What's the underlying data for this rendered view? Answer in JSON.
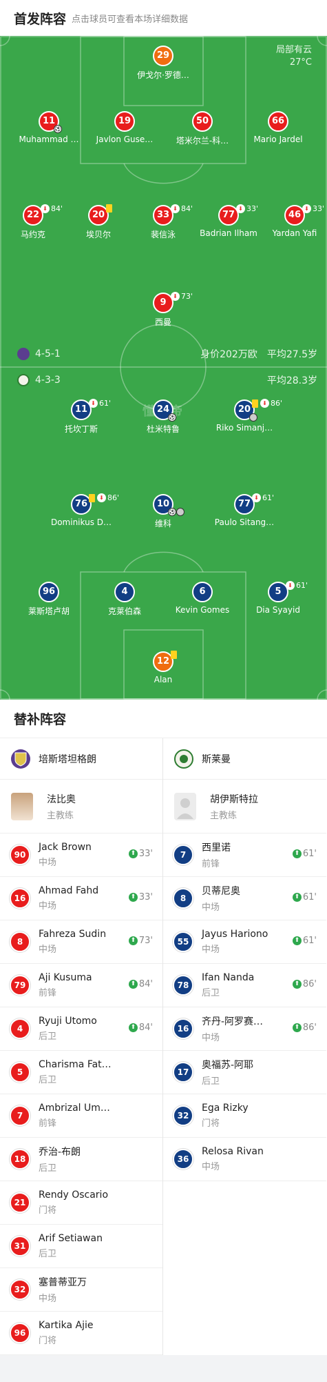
{
  "header": {
    "title": "首发阵容",
    "subtitle": "点击球员可查看本场详细数据"
  },
  "weather": {
    "condition": "局部有云",
    "temp": "27°C"
  },
  "watermark": "懂球帝",
  "home_bar": {
    "formation": "4-5-1",
    "value": "身价202万欧",
    "age": "平均27.5岁"
  },
  "away_bar": {
    "formation": "4-3-3",
    "age": "平均28.3岁"
  },
  "home_lineup": [
    {
      "num": "29",
      "name": "伊戈尔·罗德…",
      "color": "orange"
    },
    {
      "num": "11",
      "name": "Muhammad …",
      "color": "red",
      "goal": true
    },
    {
      "num": "19",
      "name": "Javlon Guse…",
      "color": "red"
    },
    {
      "num": "50",
      "name": "塔米尔兰-科…",
      "color": "red"
    },
    {
      "num": "66",
      "name": "Mario Jardel",
      "color": "red"
    },
    {
      "num": "22",
      "name": "马约克",
      "color": "red",
      "sub": "84'"
    },
    {
      "num": "20",
      "name": "埃贝尔",
      "color": "red",
      "yellow": true
    },
    {
      "num": "33",
      "name": "裴信泳",
      "color": "red",
      "sub": "84'"
    },
    {
      "num": "77",
      "name": "Badrian Ilham",
      "color": "red",
      "sub": "33'"
    },
    {
      "num": "46",
      "name": "Yardan Yafi",
      "color": "red",
      "sub": "33'"
    },
    {
      "num": "9",
      "name": "西曼",
      "color": "red",
      "sub": "73'"
    }
  ],
  "away_lineup": [
    {
      "num": "11",
      "name": "托坎丁斯",
      "color": "blue",
      "sub": "61'"
    },
    {
      "num": "24",
      "name": "杜米特鲁",
      "color": "blue",
      "goal": true
    },
    {
      "num": "20",
      "name": "Riko Simanj…",
      "color": "blue",
      "yellow": true,
      "sub": "86'",
      "owngoal": true
    },
    {
      "num": "76",
      "name": "Dominikus D…",
      "color": "blue",
      "yellow": true,
      "sub": "86'"
    },
    {
      "num": "10",
      "name": "维科",
      "color": "blue",
      "goal": true,
      "owngoal": true
    },
    {
      "num": "77",
      "name": "Paulo Sitang…",
      "color": "blue",
      "sub": "61'"
    },
    {
      "num": "96",
      "name": "莱斯塔卢胡",
      "color": "blue"
    },
    {
      "num": "4",
      "name": "克莱伯森",
      "color": "blue"
    },
    {
      "num": "6",
      "name": "Kevin Gomes",
      "color": "blue"
    },
    {
      "num": "5",
      "name": "Dia Syayid",
      "color": "blue",
      "sub": "61'"
    },
    {
      "num": "12",
      "name": "Alan",
      "color": "orange",
      "yellow": true
    }
  ],
  "bench": {
    "title": "替补阵容",
    "home": {
      "team": "培斯塔坦格朗",
      "coach": {
        "name": "法比奥",
        "role": "主教练"
      },
      "players": [
        {
          "num": "90",
          "name": "Jack Brown",
          "pos": "中场",
          "sub": "33'"
        },
        {
          "num": "16",
          "name": "Ahmad Fahd",
          "pos": "中场",
          "sub": "33'"
        },
        {
          "num": "8",
          "name": "Fahreza Sudin",
          "pos": "中场",
          "sub": "73'"
        },
        {
          "num": "79",
          "name": "Aji Kusuma",
          "pos": "前锋",
          "sub": "84'"
        },
        {
          "num": "4",
          "name": "Ryuji Utomo",
          "pos": "后卫",
          "sub": "84'"
        },
        {
          "num": "5",
          "name": "Charisma Fat…",
          "pos": "后卫"
        },
        {
          "num": "7",
          "name": "Ambrizal Um…",
          "pos": "前锋"
        },
        {
          "num": "18",
          "name": "乔治-布朗",
          "pos": "后卫"
        },
        {
          "num": "21",
          "name": "Rendy Oscario",
          "pos": "门将"
        },
        {
          "num": "31",
          "name": "Arif Setiawan",
          "pos": "后卫"
        },
        {
          "num": "32",
          "name": "塞普蒂亚万",
          "pos": "中场"
        },
        {
          "num": "96",
          "name": "Kartika Ajie",
          "pos": "门将"
        }
      ]
    },
    "away": {
      "team": "斯莱曼",
      "coach": {
        "name": "胡伊斯特拉",
        "role": "主教练"
      },
      "players": [
        {
          "num": "7",
          "name": "西里诺",
          "pos": "前锋",
          "sub": "61'"
        },
        {
          "num": "8",
          "name": "贝蒂尼奥",
          "pos": "中场",
          "sub": "61'"
        },
        {
          "num": "55",
          "name": "Jayus Hariono",
          "pos": "中场",
          "sub": "61'"
        },
        {
          "num": "78",
          "name": "Ifan Nanda",
          "pos": "后卫",
          "sub": "86'"
        },
        {
          "num": "16",
          "name": "齐丹-阿罗赛…",
          "pos": "中场",
          "sub": "86'"
        },
        {
          "num": "17",
          "name": "奥福苏-阿耶",
          "pos": "后卫"
        },
        {
          "num": "32",
          "name": "Ega Rizky",
          "pos": "门将"
        },
        {
          "num": "36",
          "name": "Relosa Rivan",
          "pos": "中场"
        }
      ]
    }
  }
}
